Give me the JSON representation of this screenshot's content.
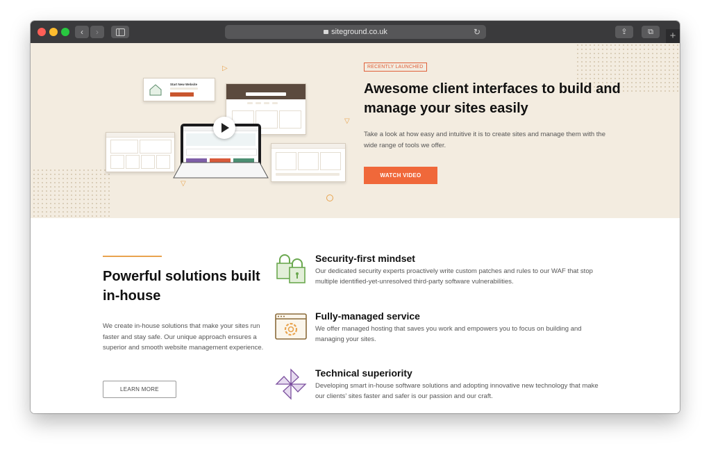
{
  "browser": {
    "url": "siteground.co.uk",
    "back_icon": "‹",
    "forward_icon": "›",
    "reload_icon": "↻",
    "share_icon": "⇪",
    "tabs_icon": "⧉",
    "newtab_icon": "+"
  },
  "hero": {
    "badge": "RECENTLY LAUNCHED",
    "title": "Awesome client interfaces to build and manage your sites easily",
    "description": "Take a look at how easy and intuitive it is to create sites and manage them with the wide range of tools we offer.",
    "cta": "WATCH VIDEO",
    "mock_start_title": "Start New Website"
  },
  "section": {
    "title": "Powerful solutions built in-house",
    "description": "We create in-house solutions that make your sites run faster and stay safe. Our unique approach ensures a superior and smooth website management experience.",
    "cta": "LEARN MORE"
  },
  "features": [
    {
      "title": "Security-first mindset",
      "description": "Our dedicated security experts proactively write custom patches and rules to our WAF that stop multiple identified-yet-unresolved third-party software vulnerabilities.",
      "icon": "padlock-icon"
    },
    {
      "title": "Fully-managed service",
      "description": "We offer managed hosting that saves you work and empowers you to focus on building and managing your sites.",
      "icon": "browser-gear-icon"
    },
    {
      "title": "Technical superiority",
      "description": "Developing smart in-house software solutions and adopting innovative new technology that make our clients’ sites faster and safer is our passion and our craft.",
      "icon": "pinwheel-icon"
    }
  ],
  "colors": {
    "accent": "#f0683a",
    "hero_bg": "#f3ece0",
    "icon_green": "#6aa84f",
    "icon_brown": "#8a6a3a",
    "icon_purple": "#7b4f9e"
  }
}
